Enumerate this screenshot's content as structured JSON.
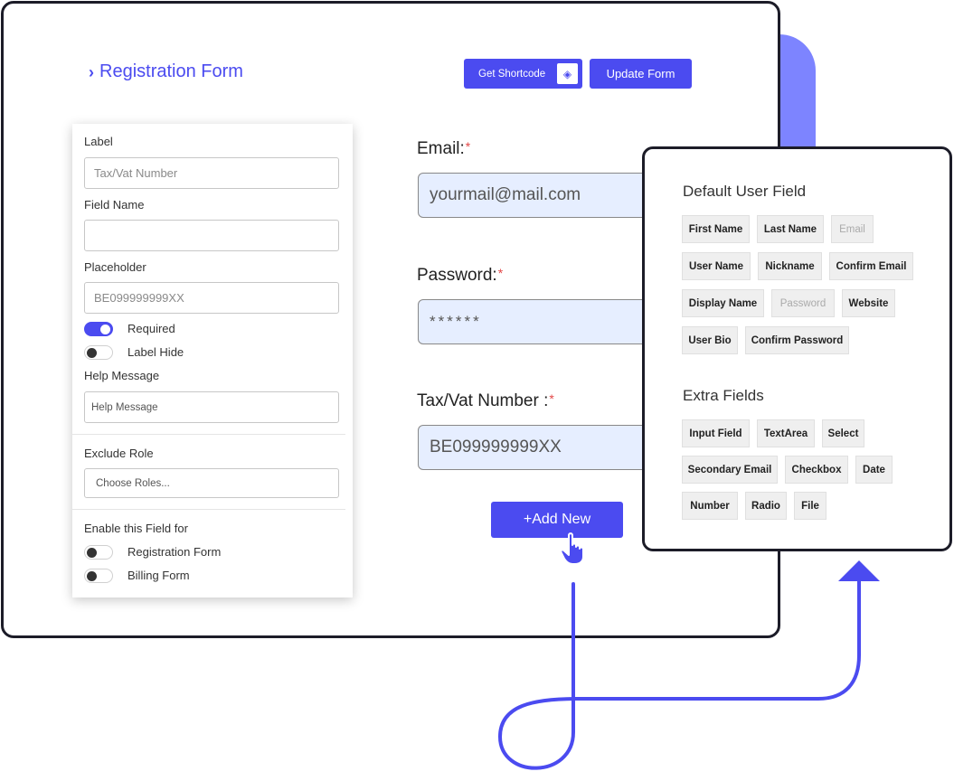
{
  "form": {
    "title": "Registration Form",
    "shortcode_button": "Get Shortcode",
    "update_button": "Update Form"
  },
  "settings": {
    "label_title": "Label",
    "label_value": "Tax/Vat Number",
    "field_name_title": "Field Name",
    "field_name_value": "",
    "placeholder_title": "Placeholder",
    "placeholder_value": "BE099999999XX",
    "required_label": "Required",
    "required_on": true,
    "label_hide_label": "Label Hide",
    "label_hide_on": false,
    "help_message_title": "Help Message",
    "help_message_placeholder": "Help Message",
    "exclude_role_title": "Exclude Role",
    "exclude_role_placeholder": "Choose Roles...",
    "enable_for_title": "Enable this Field for",
    "enable_for": [
      {
        "label": "Registration Form",
        "on": false
      },
      {
        "label": "Billing Form",
        "on": false
      }
    ]
  },
  "preview": {
    "fields": [
      {
        "label": "Email:",
        "required_mark": "*",
        "value": "yourmail@mail.com"
      },
      {
        "label": "Password:",
        "required_mark": "*",
        "value": "******"
      },
      {
        "label": "Tax/Vat Number :",
        "required_mark": "*",
        "value": "BE099999999XX"
      }
    ],
    "add_button": "+Add New"
  },
  "fields_panel": {
    "default_heading": "Default User Field",
    "default_fields": [
      {
        "label": "First Name",
        "disabled": false
      },
      {
        "label": "Last Name",
        "disabled": false
      },
      {
        "label": "Email",
        "disabled": true
      },
      {
        "label": "User Name",
        "disabled": false
      },
      {
        "label": "Nickname",
        "disabled": false
      },
      {
        "label": "Confirm Email",
        "disabled": false
      },
      {
        "label": "Display Name",
        "disabled": false
      },
      {
        "label": "Password",
        "disabled": true
      },
      {
        "label": "Website",
        "disabled": false
      },
      {
        "label": "User Bio",
        "disabled": false
      },
      {
        "label": "Confirm Password",
        "disabled": false
      }
    ],
    "extra_heading": "Extra Fields",
    "extra_fields": [
      {
        "label": "Input Field"
      },
      {
        "label": "TextArea"
      },
      {
        "label": "Select"
      },
      {
        "label": "Secondary Email"
      },
      {
        "label": "Checkbox"
      },
      {
        "label": "Date"
      },
      {
        "label": "Number"
      },
      {
        "label": "Radio"
      },
      {
        "label": "File"
      }
    ]
  },
  "colors": {
    "accent": "#4b4bf0",
    "accent_light": "#7d84ff",
    "input_bg": "#e6eeff",
    "required": "#e34848"
  }
}
